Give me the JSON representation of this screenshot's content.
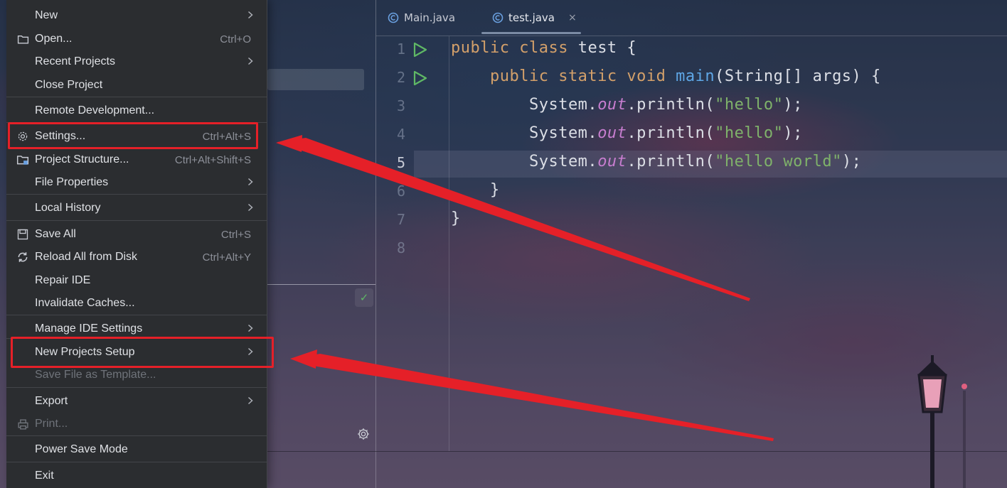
{
  "menu": {
    "items": [
      {
        "label": "New",
        "shortcut": "",
        "submenu": true,
        "icon": "",
        "disabled": false
      },
      {
        "label": "Open...",
        "shortcut": "Ctrl+O",
        "submenu": false,
        "icon": "folder-icon",
        "disabled": false
      },
      {
        "label": "Recent Projects",
        "shortcut": "",
        "submenu": true,
        "icon": "",
        "disabled": false
      },
      {
        "label": "Close Project",
        "shortcut": "",
        "submenu": false,
        "icon": "",
        "disabled": false
      },
      {
        "label": "Remote Development...",
        "shortcut": "",
        "submenu": false,
        "icon": "",
        "disabled": false
      },
      {
        "label": "Settings...",
        "shortcut": "Ctrl+Alt+S",
        "submenu": false,
        "icon": "gear-icon",
        "disabled": false
      },
      {
        "label": "Project Structure...",
        "shortcut": "Ctrl+Alt+Shift+S",
        "submenu": false,
        "icon": "project-structure-icon",
        "disabled": false
      },
      {
        "label": "File Properties",
        "shortcut": "",
        "submenu": true,
        "icon": "",
        "disabled": false
      },
      {
        "label": "Local History",
        "shortcut": "",
        "submenu": true,
        "icon": "",
        "disabled": false
      },
      {
        "label": "Save All",
        "shortcut": "Ctrl+S",
        "submenu": false,
        "icon": "save-icon",
        "disabled": false
      },
      {
        "label": "Reload All from Disk",
        "shortcut": "Ctrl+Alt+Y",
        "submenu": false,
        "icon": "reload-icon",
        "disabled": false
      },
      {
        "label": "Repair IDE",
        "shortcut": "",
        "submenu": false,
        "icon": "",
        "disabled": false
      },
      {
        "label": "Invalidate Caches...",
        "shortcut": "",
        "submenu": false,
        "icon": "",
        "disabled": false
      },
      {
        "label": "Manage IDE Settings",
        "shortcut": "",
        "submenu": true,
        "icon": "",
        "disabled": false
      },
      {
        "label": "New Projects Setup",
        "shortcut": "",
        "submenu": true,
        "icon": "",
        "disabled": false
      },
      {
        "label": "Save File as Template...",
        "shortcut": "",
        "submenu": false,
        "icon": "",
        "disabled": true
      },
      {
        "label": "Export",
        "shortcut": "",
        "submenu": true,
        "icon": "",
        "disabled": false
      },
      {
        "label": "Print...",
        "shortcut": "",
        "submenu": false,
        "icon": "print-icon",
        "disabled": true
      },
      {
        "label": "Power Save Mode",
        "shortcut": "",
        "submenu": false,
        "icon": "",
        "disabled": false
      },
      {
        "label": "Exit",
        "shortcut": "",
        "submenu": false,
        "icon": "",
        "disabled": false
      }
    ]
  },
  "tabs": [
    {
      "label": "Main.java",
      "icon": "java-class-icon",
      "active": false
    },
    {
      "label": "test.java",
      "icon": "java-class-icon",
      "active": true
    }
  ],
  "tab_close_glyph": "×",
  "editor": {
    "line_numbers": [
      "1",
      "2",
      "3",
      "4",
      "5",
      "6",
      "7",
      "8"
    ],
    "active_line": "5",
    "lines": [
      [
        {
          "t": "public class",
          "c": "kw"
        },
        {
          "t": " test {",
          "c": ""
        }
      ],
      [
        {
          "t": "    public static void ",
          "c": "kw"
        },
        {
          "t": "main",
          "c": "fn"
        },
        {
          "t": "(String[] args) {",
          "c": ""
        }
      ],
      [
        {
          "t": "        System.",
          "c": ""
        },
        {
          "t": "out",
          "c": "fld"
        },
        {
          "t": ".println(",
          "c": ""
        },
        {
          "t": "\"hello\"",
          "c": "str"
        },
        {
          "t": ");",
          "c": ""
        }
      ],
      [
        {
          "t": "        System.",
          "c": ""
        },
        {
          "t": "out",
          "c": "fld"
        },
        {
          "t": ".println(",
          "c": ""
        },
        {
          "t": "\"hello\"",
          "c": "str"
        },
        {
          "t": ");",
          "c": ""
        }
      ],
      [
        {
          "t": "        System.",
          "c": ""
        },
        {
          "t": "out",
          "c": "fld"
        },
        {
          "t": ".println(",
          "c": ""
        },
        {
          "t": "\"hello world\"",
          "c": "str"
        },
        {
          "t": ");",
          "c": ""
        }
      ],
      [
        {
          "t": "    }",
          "c": ""
        }
      ],
      [
        {
          "t": "}",
          "c": ""
        }
      ],
      []
    ]
  },
  "colors": {
    "menu_bg": "#2b2d30",
    "annotation_red": "#e52028",
    "keyword": "#d3a06a",
    "function": "#5fa7e6",
    "field": "#c77dcf",
    "string": "#7fb26a",
    "run_green": "#5fb865"
  },
  "annotations": {
    "highlighted_items": [
      "Settings...",
      "New Projects Setup"
    ]
  }
}
